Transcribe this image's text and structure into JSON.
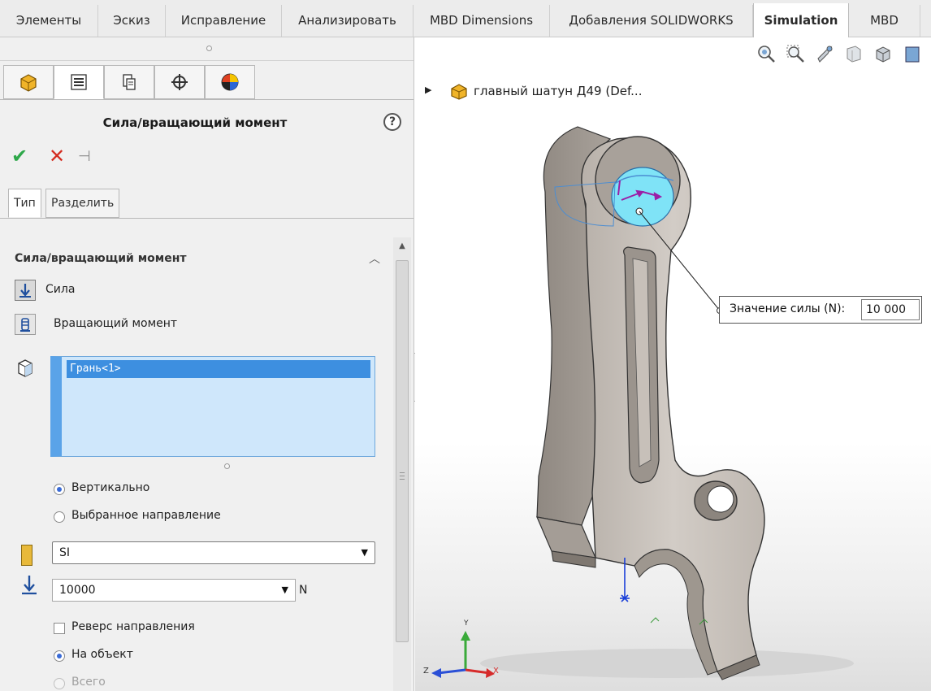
{
  "ribbon_tabs": [
    {
      "label": "Элементы"
    },
    {
      "label": "Эскиз"
    },
    {
      "label": "Исправление"
    },
    {
      "label": "Анализировать"
    },
    {
      "label": "MBD Dimensions"
    },
    {
      "label": "Добавления SOLIDWORKS"
    },
    {
      "label": "Simulation"
    },
    {
      "label": "MBD"
    }
  ],
  "active_ribbon_tab": "Simulation",
  "manager_tabs": [
    {
      "icon": "feature-manager-icon"
    },
    {
      "icon": "property-manager-icon"
    },
    {
      "icon": "configuration-manager-icon"
    },
    {
      "icon": "dimxpert-manager-icon"
    },
    {
      "icon": "display-manager-icon"
    }
  ],
  "property_manager": {
    "title": "Сила/вращающий момент",
    "help_icon": "?",
    "tabs": [
      "Тип",
      "Разделить"
    ],
    "group_title": "Сила/вращающий момент",
    "options": {
      "force": "Сила",
      "torque": "Вращающий момент"
    },
    "selection_items": [
      "Грань<1>"
    ],
    "direction": {
      "vertical": "Вертикально",
      "selected": "Выбранное направление"
    },
    "unit_system": "SI",
    "force_value": "10000",
    "force_unit": "N",
    "reverse_direction": "Реверс направления",
    "per_item": "На объект",
    "total": "Всего"
  },
  "viewport": {
    "tree_label": "главный шатун Д49  (Def...",
    "callout_label": "Значение силы (N):",
    "callout_value": "10 000",
    "triad": {
      "x": "X",
      "y": "Y",
      "z": "Z"
    }
  },
  "colors": {
    "active_tab_bg": "#ffffff",
    "selection_bg": "#cfe7fb",
    "selection_item": "#3d8fe0",
    "part_face": "#c9c2bb",
    "highlight_face": "#7fe3f7",
    "load_arrow": "#9b1fa6",
    "ok_green": "#2ea84a",
    "cancel_red": "#d42c20"
  }
}
